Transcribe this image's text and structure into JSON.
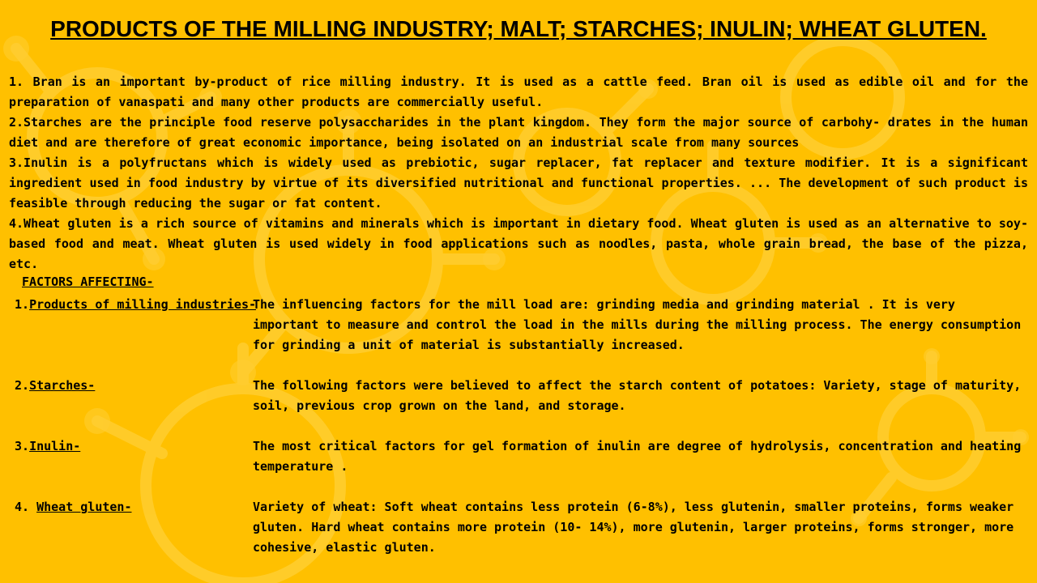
{
  "title": "PRODUCTS OF THE MILLING INDUSTRY; MALT; STARCHES; INULIN; WHEAT GLUTEN.",
  "points": [
    "1. Bran is an important by-product of rice milling industry. It is used as a cattle feed. Bran oil is used as edible oil and for the preparation of vanaspati and many other products are commercially useful.",
    "2.Starches are the principle food reserve polysaccharides in the plant kingdom. They form the major source of carbohy- drates in the human diet and are therefore of great economic importance, being isolated on an industrial scale from many sources",
    "3.Inulin is a polyfructans which is widely used as prebiotic, sugar replacer, fat replacer and texture modifier. It is a significant ingredient used in food industry by virtue of its diversified nutritional and functional properties. ... The development of such product is feasible through reducing the sugar or fat content.",
    "4.Wheat gluten is a rich source of vitamins and minerals which is important in dietary food. Wheat gluten is used as an alternative to soy-based food and meat. Wheat gluten is used widely in food applications such as noodles, pasta, whole grain bread, the base of the pizza, etc."
  ],
  "factors_heading": "FACTORS AFFECTING-",
  "factors": [
    {
      "number": "1.",
      "name": "Products of milling industries-",
      "description": "The influencing factors for the mill load are: grinding media and grinding material . It is very important to measure  and control the load in the mills during the milling process. The energy consumption for grinding a unit of material is substantially increased."
    },
    {
      "number": "2.",
      "name": "Starches-",
      "description": "The following factors were believed to affect the starch content of potatoes: Variety, stage of maturity, soil, previous crop grown on the land, and storage."
    },
    {
      "number": "3.",
      "name": "Inulin-",
      "description": "The most critical factors for gel formation of inulin are degree of hydrolysis, concentration and heating temperature ."
    },
    {
      "number": "4. ",
      "name": "Wheat gluten-",
      "description": "Variety of wheat: Soft wheat contains less protein (6-8%), less glutenin, smaller proteins, forms weaker gluten. Hard wheat contains more protein (10- 14%), more glutenin, larger proteins, forms stronger, more cohesive, elastic gluten."
    }
  ]
}
